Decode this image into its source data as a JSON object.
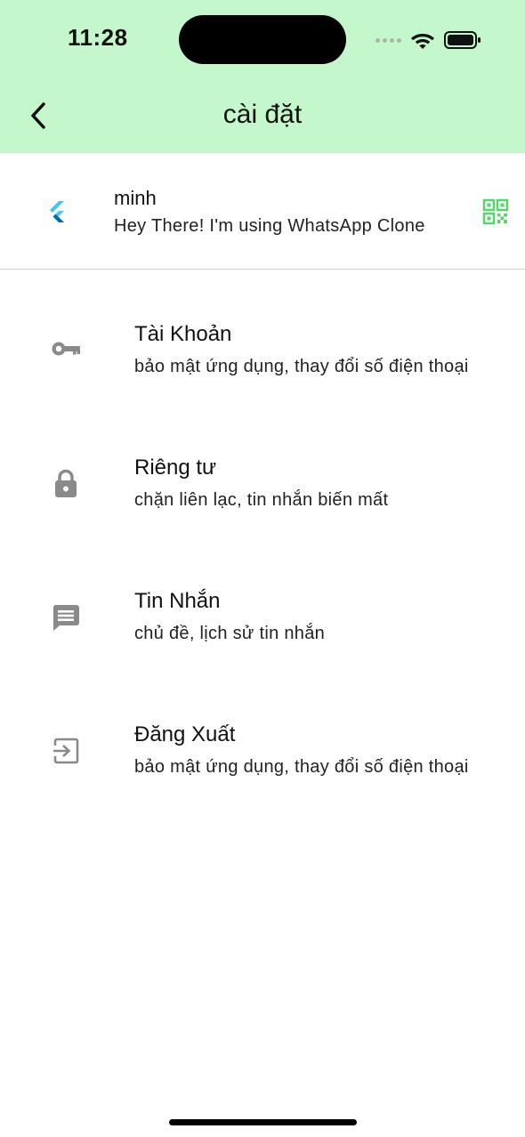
{
  "status_bar": {
    "time": "11:28"
  },
  "app_bar": {
    "title": "cài đặt",
    "back_icon": "chevron-left-icon",
    "background_color": "#c4f7cc"
  },
  "profile": {
    "avatar_icon": "flutter-logo-icon",
    "name": "minh",
    "status": "Hey There! I'm using WhatsApp Clone",
    "qr_icon": "qr-code-icon",
    "accent_color": "#55d66b"
  },
  "settings": {
    "items": [
      {
        "icon": "key-icon",
        "title": "Tài Khoản",
        "subtitle": "bảo mật ứng dụng, thay đổi số điện thoại"
      },
      {
        "icon": "lock-icon",
        "title": "Riêng tư",
        "subtitle": "chặn liên lạc, tin nhắn biến mất"
      },
      {
        "icon": "message-icon",
        "title": "Tin Nhắn",
        "subtitle": "chủ đề, lịch sử tin nhắn"
      },
      {
        "icon": "logout-icon",
        "title": "Đăng Xuất",
        "subtitle": "bảo mật ứng dụng, thay đổi số điện thoại"
      }
    ]
  }
}
